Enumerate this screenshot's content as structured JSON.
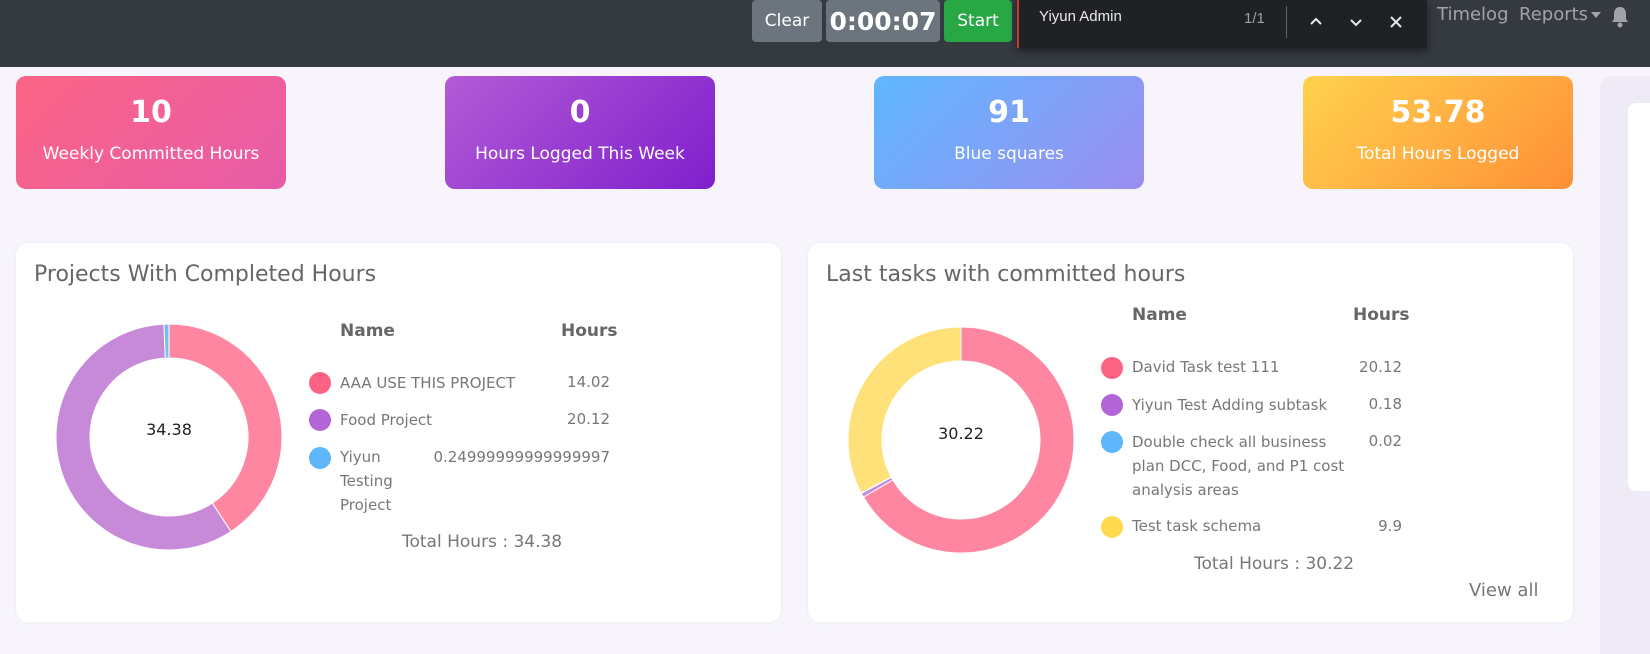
{
  "navbar": {
    "clear_label": "Clear",
    "timer_value": "0:00:07",
    "start_label": "Start",
    "timelog_label": "Timelog",
    "reports_label": "Reports"
  },
  "find": {
    "query": "Yiyun Admin",
    "count": "1/1"
  },
  "stats": [
    {
      "value": "10",
      "label": "Weekly Committed Hours"
    },
    {
      "value": "0",
      "label": "Hours Logged This Week"
    },
    {
      "value": "91",
      "label": "Blue squares"
    },
    {
      "value": "53.78",
      "label": "Total Hours Logged"
    }
  ],
  "projects": {
    "title": "Projects With Completed Hours",
    "center": "34.38",
    "col_name": "Name",
    "col_hours": "Hours",
    "rows": [
      {
        "name": "AAA USE THIS PROJECT",
        "hours": "14.02",
        "color": "#ff6384"
      },
      {
        "name": "Food Project",
        "hours": "20.12",
        "color": "#b364d6"
      },
      {
        "name": "Yiyun Testing Project",
        "hours": "0.24999999999999997",
        "color": "#5eb6fb"
      }
    ],
    "total": "Total Hours : 34.38"
  },
  "tasks": {
    "title": "Last tasks with committed hours",
    "center": "30.22",
    "col_name": "Name",
    "col_hours": "Hours",
    "rows": [
      {
        "name": "David Task test 111",
        "hours": "20.12",
        "color": "#ff6384"
      },
      {
        "name": "Yiyun Test Adding subtask",
        "hours": "0.18",
        "color": "#b364d6"
      },
      {
        "name": "Double check all business plan DCC, Food, and P1 cost analysis areas",
        "hours": "0.02",
        "color": "#5eb6fb"
      },
      {
        "name": "Test task schema",
        "hours": "9.9",
        "color": "#ffd94f"
      }
    ],
    "total": "Total Hours : 30.22",
    "view_all": "View all"
  },
  "chart_data": [
    {
      "type": "pie",
      "title": "Projects With Completed Hours",
      "categories": [
        "AAA USE THIS PROJECT",
        "Food Project",
        "Yiyun Testing Project"
      ],
      "values": [
        14.02,
        20.12,
        0.25
      ],
      "colors": [
        "#fe86a0",
        "#c68ad9",
        "#70c0f6"
      ]
    },
    {
      "type": "pie",
      "title": "Last tasks with committed hours",
      "categories": [
        "David Task test 111",
        "Yiyun Test Adding subtask",
        "Double check all business plan DCC, Food, and P1 cost analysis areas",
        "Test task schema"
      ],
      "values": [
        20.12,
        0.18,
        0.02,
        9.9
      ],
      "colors": [
        "#fe86a0",
        "#c68ad9",
        "#70c0f6",
        "#ffe17a"
      ]
    }
  ]
}
